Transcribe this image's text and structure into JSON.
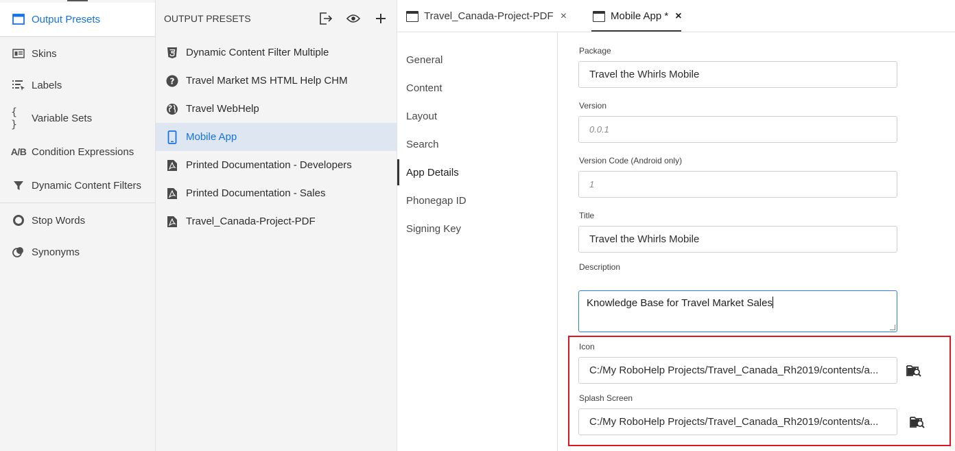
{
  "nav": {
    "items": [
      {
        "label": "Output Presets",
        "icon": "window-icon"
      },
      {
        "label": "Skins",
        "icon": "skins-icon"
      },
      {
        "label": "Labels",
        "icon": "labels-icon"
      },
      {
        "label": "Variable Sets",
        "icon": "braces-icon"
      },
      {
        "label": "Condition Expressions",
        "icon": "ab-icon",
        "icon_text": "A/B"
      },
      {
        "label": "Dynamic Content Filters",
        "icon": "filter-icon"
      },
      {
        "label": "Stop Words",
        "icon": "stop-icon"
      },
      {
        "label": "Synonyms",
        "icon": "synonyms-icon"
      }
    ],
    "active_color": "#1473e6"
  },
  "presets": {
    "title": "OUTPUT PRESETS",
    "items": [
      {
        "label": "Dynamic Content Filter Multiple",
        "icon": "html5-icon"
      },
      {
        "label": "Travel Market MS HTML Help CHM",
        "icon": "help-icon"
      },
      {
        "label": "Travel WebHelp",
        "icon": "globe-icon"
      },
      {
        "label": "Mobile App",
        "icon": "mobile-icon"
      },
      {
        "label": "Printed Documentation - Developers",
        "icon": "pdf-icon"
      },
      {
        "label": "Printed Documentation - Sales",
        "icon": "pdf-icon"
      },
      {
        "label": "Travel_Canada-Project-PDF",
        "icon": "pdf-icon"
      }
    ],
    "selected_color": "#dde6f1"
  },
  "tabs": [
    {
      "label": "Travel_Canada-Project-PDF",
      "close": "×"
    },
    {
      "label": "Mobile App *",
      "close": "×"
    }
  ],
  "subnav": [
    "General",
    "Content",
    "Layout",
    "Search",
    "App Details",
    "Phonegap ID",
    "Signing Key"
  ],
  "form": {
    "package": {
      "label": "Package",
      "value": "Travel the Whirls Mobile"
    },
    "version": {
      "label": "Version",
      "placeholder": "0.0.1"
    },
    "version_code": {
      "label": "Version Code (Android only)",
      "placeholder": "1"
    },
    "title": {
      "label": "Title",
      "value": "Travel the Whirls Mobile"
    },
    "description": {
      "label": "Description",
      "value": "Knowledge Base for Travel Market Sales"
    },
    "icon": {
      "label": "Icon",
      "value": "C:/My RoboHelp Projects/Travel_Canada_Rh2019/contents/a..."
    },
    "splash": {
      "label": "Splash Screen",
      "value": "C:/My RoboHelp Projects/Travel_Canada_Rh2019/contents/a..."
    }
  },
  "highlight_color": "#e0161e"
}
